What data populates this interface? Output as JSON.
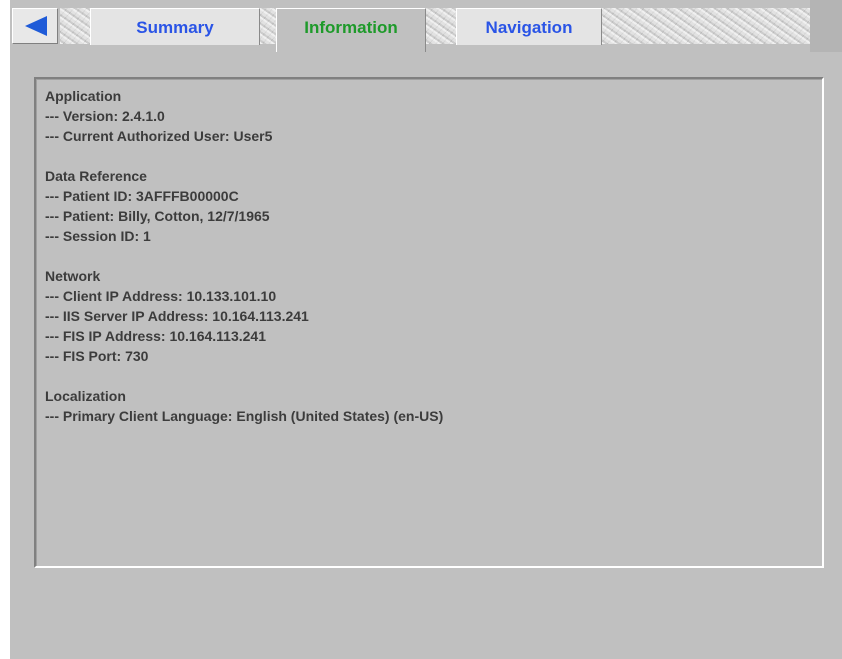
{
  "tabs": [
    {
      "label": "Summary",
      "active": false
    },
    {
      "label": "Information",
      "active": true
    },
    {
      "label": "Navigation",
      "active": false
    }
  ],
  "colors": {
    "inactive_tab_text": "#2a54e6",
    "active_tab_text": "#1e9a2a",
    "back_arrow": "#1f5bd8",
    "background": "#c0c0c0"
  },
  "icons": {
    "back": "back-arrow-icon"
  },
  "info": {
    "application": {
      "title": "Application",
      "version": "--- Version: 2.4.1.0",
      "user": "--- Current Authorized User: User5"
    },
    "data_reference": {
      "title": "Data Reference",
      "patient_id": "--- Patient ID: 3AFFFB00000C",
      "patient": "--- Patient: Billy, Cotton, 12/7/1965",
      "session_id": "--- Session ID: 1"
    },
    "network": {
      "title": "Network",
      "client_ip": "--- Client IP Address: 10.133.101.10",
      "iis_ip": "--- IIS Server IP Address: 10.164.113.241",
      "fis_ip": "--- FIS IP Address: 10.164.113.241",
      "fis_port": "--- FIS Port: 730"
    },
    "localization": {
      "title": "Localization",
      "language": "--- Primary Client Language: English (United States) (en-US)"
    }
  }
}
